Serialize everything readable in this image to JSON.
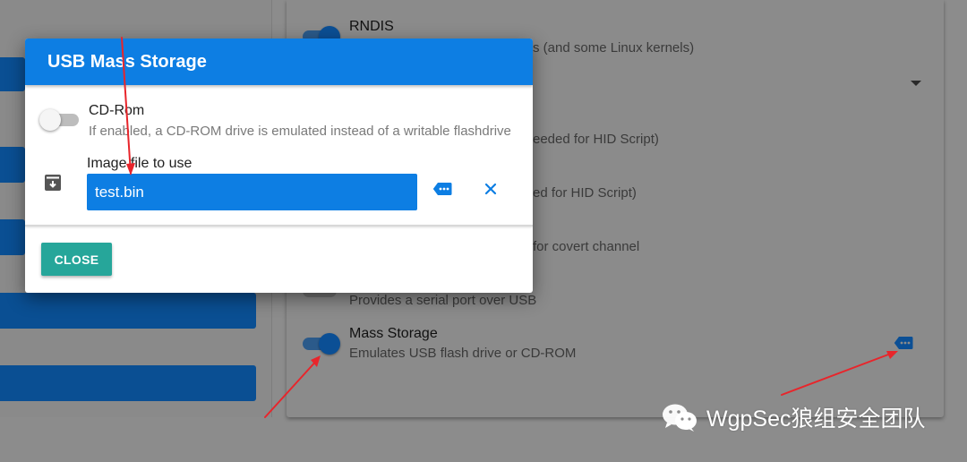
{
  "modal": {
    "title": "USB Mass Storage",
    "cdrom": {
      "label": "CD-Rom",
      "description": "If enabled, a CD-ROM drive is emulated instead of a writable flashdrive",
      "enabled": false
    },
    "image_file": {
      "label": "Image file to use",
      "value": "test.bin"
    },
    "close_label": "CLOSE"
  },
  "background": {
    "rndis": {
      "title": "RNDIS",
      "description_partial": "s (and some Linux kernels)",
      "enabled": true
    },
    "row_hid1_partial": "eeded for HID Script)",
    "row_hid2_partial": "ed for HID Script)",
    "row_covert_partial": "for covert channel",
    "row_serial_desc": "Provides a serial port over USB",
    "mass_storage": {
      "title": "Mass Storage",
      "description": "Emulates USB flash drive or CD-ROM",
      "enabled": true
    }
  },
  "watermark": {
    "text": "WgpSec狼组安全团队"
  },
  "colors": {
    "primary": "#0d7ee3",
    "close_button": "#26a69a",
    "arrow": "#e8252b",
    "overlay_bg": "#8c8c8c"
  }
}
